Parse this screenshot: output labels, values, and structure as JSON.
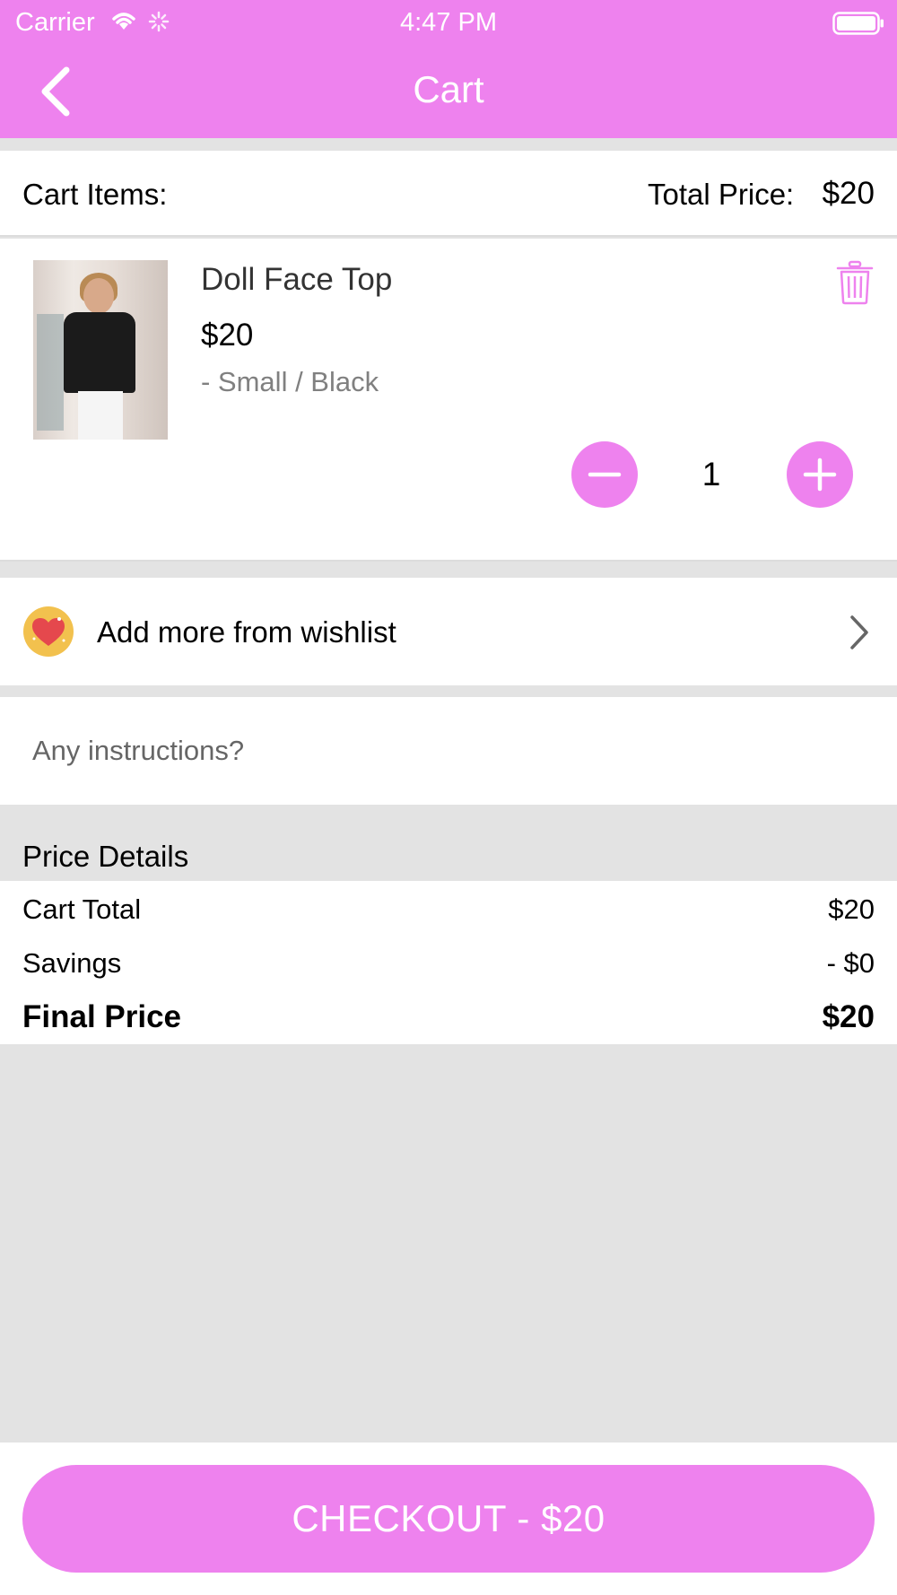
{
  "status_bar": {
    "carrier": "Carrier",
    "time": "4:47 PM"
  },
  "header": {
    "title": "Cart",
    "accent_color": "#ee82ee"
  },
  "cart_summary": {
    "items_label": "Cart Items:",
    "total_price_label": "Total Price:",
    "total_price_value": "$20"
  },
  "cart_items": [
    {
      "name": "Doll Face Top",
      "price": "$20",
      "variant": "- Small / Black",
      "quantity": "1"
    }
  ],
  "wishlist": {
    "label": "Add more from wishlist"
  },
  "instructions": {
    "placeholder": "Any instructions?"
  },
  "price_details": {
    "title": "Price Details",
    "rows": [
      {
        "label": "Cart Total",
        "value": "$20"
      },
      {
        "label": "Savings",
        "value": "- $0"
      },
      {
        "label": "Final Price",
        "value": "$20"
      }
    ]
  },
  "checkout": {
    "label": "CHECKOUT - $20"
  },
  "icons": {
    "back": "chevron-left-icon",
    "trash": "trash-icon",
    "minus": "minus-icon",
    "plus": "plus-icon",
    "wishlist": "heart-icon",
    "chevron": "chevron-right-icon"
  }
}
